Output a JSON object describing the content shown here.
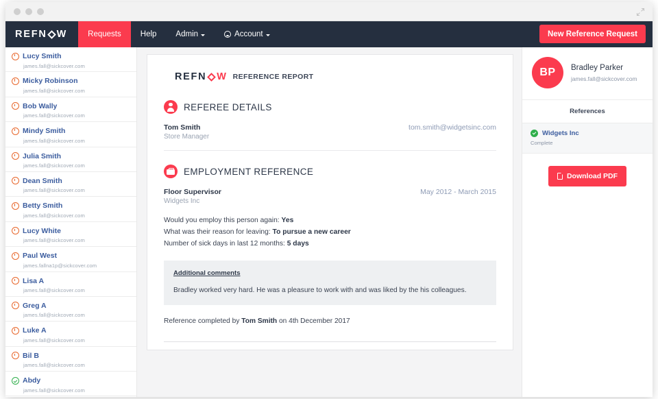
{
  "browser": {
    "traffic_lights": [
      "dot",
      "dot",
      "dot"
    ],
    "expand_icon": "expand-arrows-icon"
  },
  "navbar": {
    "brand": {
      "part1": "REFN",
      "part2": "W",
      "diamond_icon": "diamond-icon"
    },
    "links": [
      {
        "label": "Requests",
        "active": true
      },
      {
        "label": "Help",
        "active": false
      },
      {
        "label": "Admin",
        "active": false,
        "caret": true
      },
      {
        "label": "Account",
        "active": false,
        "caret": true,
        "icon": "account-circle-icon"
      }
    ],
    "new_request_label": "New Reference Request",
    "bg_color": "#252f3f",
    "accent_color": "#fb3b4e"
  },
  "sidebar": {
    "requests": [
      {
        "name": "Lucy Smith",
        "email": "james.fall@sickcover.com",
        "status": "pending"
      },
      {
        "name": "Micky Robinson",
        "email": "james.fall@sickcover.com",
        "status": "pending"
      },
      {
        "name": "Bob Wally",
        "email": "james.fall@sickcover.com",
        "status": "pending"
      },
      {
        "name": "Mindy Smith",
        "email": "james.fall@sickcover.com",
        "status": "pending"
      },
      {
        "name": "Julia Smith",
        "email": "james.fall@sickcover.com",
        "status": "pending"
      },
      {
        "name": "Dean Smith",
        "email": "james.fall@sickcover.com",
        "status": "pending"
      },
      {
        "name": "Betty Smith",
        "email": "james.fall@sickcover.com",
        "status": "pending"
      },
      {
        "name": "Lucy White",
        "email": "james.fall@sickcover.com",
        "status": "pending"
      },
      {
        "name": "Paul West",
        "email": "james.fallna1p@sickcover.com",
        "status": "pending"
      },
      {
        "name": "Lisa A",
        "email": "james.fall@sickcover.com",
        "status": "pending"
      },
      {
        "name": "Greg A",
        "email": "james.fall@sickcover.com",
        "status": "pending"
      },
      {
        "name": "Luke A",
        "email": "james.fall@sickcover.com",
        "status": "pending"
      },
      {
        "name": "Bil B",
        "email": "james.fall@sickcover.com",
        "status": "pending"
      },
      {
        "name": "Abdy",
        "email": "james.fall@sickcover.com",
        "status": "complete"
      }
    ]
  },
  "report": {
    "logo": {
      "part1": "REFN",
      "part2": "W",
      "diamond_icon": "diamond-icon"
    },
    "logo_label": "REFERENCE REPORT",
    "referee": {
      "section_title": "REFEREE DETAILS",
      "badge_icon": "person-icon",
      "name": "Tom Smith",
      "role": "Store Manager",
      "email": "tom.smith@widgetsinc.com"
    },
    "employment": {
      "section_title": "EMPLOYMENT REFERENCE",
      "badge_icon": "briefcase-icon",
      "job_title": "Floor Supervisor",
      "company": "Widgets Inc",
      "dates": "May 2012 - March 2015",
      "questions": [
        {
          "question": "Would you employ this person again:",
          "answer": "Yes"
        },
        {
          "question": "What was their reason for leaving:",
          "answer": "To pursue a new career"
        },
        {
          "question": "Number of sick days in last 12 months:",
          "answer": "5 days"
        }
      ],
      "comments_title": "Additional comments",
      "comments_body": "Bradley worked very hard. He was a pleasure to work with and was liked by the his colleagues.",
      "completed_prefix": "Reference completed by",
      "completed_by": "Tom Smith",
      "completed_suffix": "on 4th December 2017"
    }
  },
  "right_panel": {
    "avatar_initials": "BP",
    "name": "Bradley Parker",
    "email": "james.fall@sickcover.com",
    "references_header": "References",
    "reference": {
      "company": "Widgets Inc",
      "status": "Complete",
      "check_icon": "check-circle-icon"
    },
    "download_label": "Download PDF",
    "download_icon": "pdf-file-icon"
  }
}
